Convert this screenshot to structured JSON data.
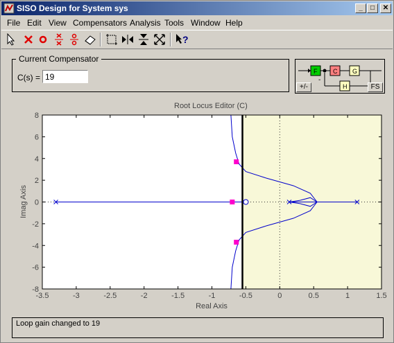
{
  "window": {
    "title": "SISO Design for System sys",
    "minimize_label": "_",
    "maximize_label": "□",
    "close_label": "✕"
  },
  "menu": [
    {
      "label": "File"
    },
    {
      "label": "Edit"
    },
    {
      "label": "View"
    },
    {
      "label": "Compensators"
    },
    {
      "label": "Analysis"
    },
    {
      "label": "Tools"
    },
    {
      "label": "Window"
    },
    {
      "label": "Help"
    }
  ],
  "toolbar": [
    {
      "icon": "pointer-arrow-icon"
    },
    {
      "icon": "add-real-pole-icon"
    },
    {
      "icon": "add-real-zero-icon"
    },
    {
      "icon": "add-complex-poles-icon"
    },
    {
      "icon": "add-complex-zeros-icon"
    },
    {
      "icon": "eraser-icon"
    },
    {
      "icon": "zoom-xy-icon"
    },
    {
      "icon": "zoom-x-icon"
    },
    {
      "icon": "zoom-y-icon"
    },
    {
      "icon": "fit-axes-icon"
    },
    {
      "icon": "context-help-icon"
    }
  ],
  "compensator": {
    "group_label": "Current Compensator",
    "cs_label": "C(s) =",
    "cs_value": "19"
  },
  "architecture": {
    "blocks": [
      "F",
      "C",
      "G",
      "H"
    ],
    "sign_label": "-",
    "toggle_label": "+/-",
    "fs_label": "FS"
  },
  "editor": {
    "title": "Root Locus Editor (C)"
  },
  "colors": {
    "locus": "#0000cc",
    "closed_loop_pole": "#ff00cc",
    "unstable_region": "#f8f8d8",
    "stability_boundary": "#000000"
  },
  "chart_data": {
    "type": "scatter",
    "title": "Root Locus Editor (C)",
    "xlabel": "Real Axis",
    "ylabel": "Imag Axis",
    "xlim": [
      -3.5,
      1.5
    ],
    "ylim": [
      -8,
      8
    ],
    "xticks": [
      -3.5,
      -3,
      -2.5,
      -2,
      -1.5,
      -1,
      -0.5,
      0,
      0.5,
      1,
      1.5
    ],
    "xtick_labels": [
      "-3.5",
      "-3",
      "-2.5",
      "-2",
      "-1.5",
      "-1",
      "-0.5",
      "0",
      "0.5",
      "1",
      "1.5"
    ],
    "yticks": [
      -8,
      -6,
      -4,
      -2,
      0,
      2,
      4,
      6,
      8
    ],
    "ytick_labels": [
      "-8",
      "-6",
      "-4",
      "-2",
      "0",
      "2",
      "4",
      "6",
      "8"
    ],
    "stability_boundary_x": -0.55,
    "open_loop_poles": [
      [
        -3.3,
        0
      ],
      [
        0.14,
        0
      ],
      [
        1.14,
        0
      ]
    ],
    "open_loop_zeros": [
      [
        -0.5,
        0
      ]
    ],
    "closed_loop_poles": [
      [
        -0.64,
        3.7
      ],
      [
        -0.64,
        -3.7
      ],
      [
        -0.7,
        0
      ]
    ],
    "locus_branches": [
      {
        "name": "real-left",
        "x": [
          -3.3,
          -0.5
        ],
        "y": [
          0,
          0
        ]
      },
      {
        "name": "real-right",
        "x": [
          0.14,
          1.14
        ],
        "y": [
          0,
          0
        ]
      },
      {
        "name": "upper",
        "x": [
          0.14,
          0.3,
          0.45,
          0.55,
          0.45,
          0.2,
          -0.2,
          -0.5,
          -0.6,
          -0.65,
          -0.7,
          -0.72
        ],
        "y": [
          0,
          0.15,
          0.4,
          0,
          0.8,
          1.5,
          2.2,
          2.8,
          3.5,
          4.5,
          6,
          8
        ]
      },
      {
        "name": "lower",
        "x": [
          0.14,
          0.3,
          0.45,
          0.55,
          0.45,
          0.2,
          -0.2,
          -0.5,
          -0.6,
          -0.65,
          -0.7,
          -0.72
        ],
        "y": [
          0,
          -0.15,
          -0.4,
          0,
          -0.8,
          -1.5,
          -2.2,
          -2.8,
          -3.5,
          -4.5,
          -6,
          -8
        ]
      }
    ]
  },
  "status": {
    "message": "Loop gain changed to 19"
  }
}
